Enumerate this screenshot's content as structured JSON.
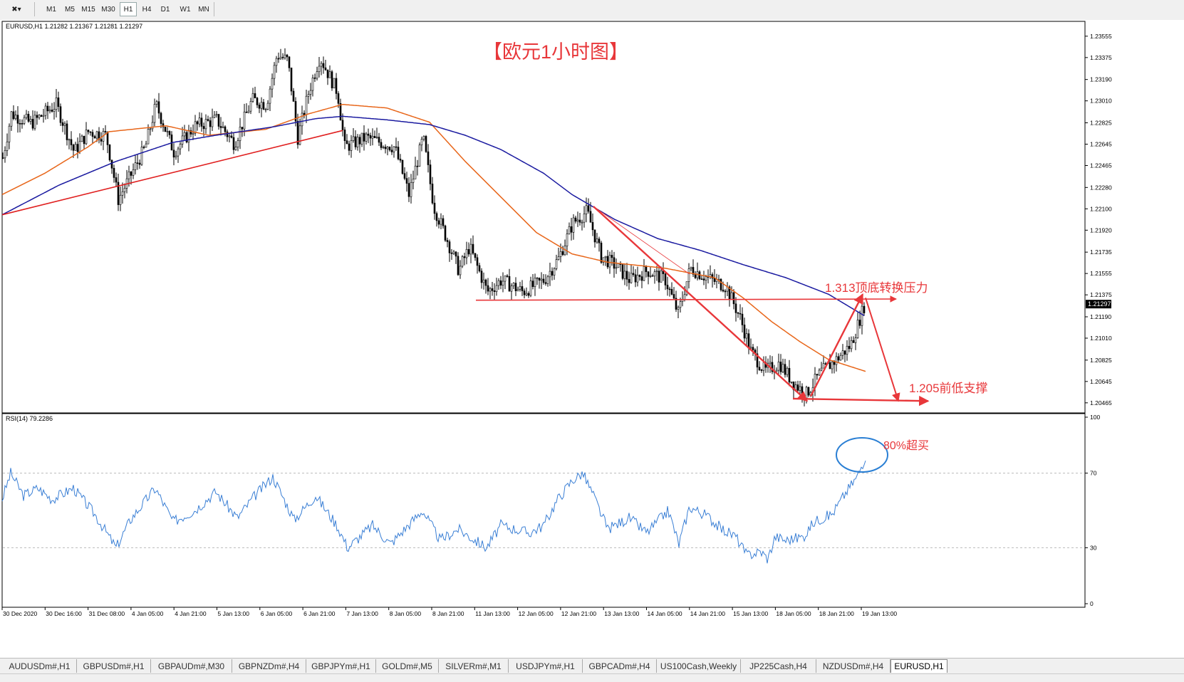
{
  "toolbar": {
    "cursor_tool": "crosshair-icon",
    "timeframes": [
      "M1",
      "M5",
      "M15",
      "M30",
      "H1",
      "H4",
      "D1",
      "W1",
      "MN"
    ],
    "active_timeframe": "H1"
  },
  "chart": {
    "header": "EURUSD,H1  1.21282 1.21367 1.21281 1.21297",
    "title": "【欧元1小时图】",
    "current_price": "1.21297",
    "price_ticks": [
      "1.23555",
      "1.23375",
      "1.23190",
      "1.23010",
      "1.22825",
      "1.22645",
      "1.22465",
      "1.22280",
      "1.22100",
      "1.21920",
      "1.21735",
      "1.21555",
      "1.21375",
      "1.21190",
      "1.21010",
      "1.20825",
      "1.20645",
      "1.20465"
    ],
    "time_ticks": [
      "30 Dec 2020",
      "30 Dec 16:00",
      "31 Dec 08:00",
      "4 Jan 05:00",
      "4 Jan 21:00",
      "5 Jan 13:00",
      "6 Jan 05:00",
      "6 Jan 21:00",
      "7 Jan 13:00",
      "8 Jan 05:00",
      "8 Jan 21:00",
      "11 Jan 13:00",
      "12 Jan 05:00",
      "12 Jan 21:00",
      "13 Jan 13:00",
      "14 Jan 05:00",
      "14 Jan 21:00",
      "15 Jan 13:00",
      "18 Jan 05:00",
      "18 Jan 21:00",
      "19 Jan 13:00"
    ],
    "annotations": {
      "resistance": "1.313顶底转换压力",
      "support": "1.205前低支撑",
      "overbought": "80%超买"
    },
    "colors": {
      "ema_orange": "#e8661a",
      "ma_blue": "#1a1aa0",
      "annotation_red": "#e8373a",
      "rsi_line": "#3a7fd5",
      "highlight_circle": "#2a7fd4"
    }
  },
  "rsi": {
    "header": "RSI(14) 79.2286",
    "levels": [
      "100",
      "70",
      "30",
      "0"
    ]
  },
  "tabs": {
    "items": [
      "AUDUSDm#,H1",
      "GBPUSDm#,H1",
      "GBPAUDm#,M30",
      "GBPNZDm#,H4",
      "GBPJPYm#,H1",
      "GOLDm#,M5",
      "SILVERm#,M1",
      "USDJPYm#,H1",
      "GBPCADm#,H4",
      "US100Cash,Weekly",
      "JP225Cash,H4",
      "NZDUSDm#,H4",
      "EURUSD,H1"
    ],
    "active": "EURUSD,H1"
  },
  "chart_data": {
    "type": "candlestick",
    "symbol": "EURUSD",
    "timeframe": "H1",
    "ylim": [
      1.2038,
      1.2368
    ],
    "price_path_knots": [
      [
        0,
        1.2253
      ],
      [
        12,
        1.229
      ],
      [
        40,
        1.2282
      ],
      [
        75,
        1.2298
      ],
      [
        100,
        1.2258
      ],
      [
        120,
        1.2275
      ],
      [
        145,
        1.2272
      ],
      [
        162,
        1.2218
      ],
      [
        200,
        1.2262
      ],
      [
        215,
        1.2298
      ],
      [
        240,
        1.2258
      ],
      [
        270,
        1.228
      ],
      [
        300,
        1.2285
      ],
      [
        325,
        1.2265
      ],
      [
        350,
        1.2302
      ],
      [
        370,
        1.2298
      ],
      [
        385,
        1.234
      ],
      [
        400,
        1.2335
      ],
      [
        414,
        1.227
      ],
      [
        430,
        1.231
      ],
      [
        445,
        1.2338
      ],
      [
        470,
        1.2308
      ],
      [
        480,
        1.2262
      ],
      [
        510,
        1.227
      ],
      [
        550,
        1.2262
      ],
      [
        570,
        1.2222
      ],
      [
        590,
        1.227
      ],
      [
        605,
        1.2212
      ],
      [
        625,
        1.2182
      ],
      [
        640,
        1.2158
      ],
      [
        655,
        1.2178
      ],
      [
        680,
        1.214
      ],
      [
        700,
        1.215
      ],
      [
        730,
        1.214
      ],
      [
        760,
        1.215
      ],
      [
        780,
        1.2168
      ],
      [
        800,
        1.2198
      ],
      [
        820,
        1.2208
      ],
      [
        840,
        1.217
      ],
      [
        860,
        1.2162
      ],
      [
        880,
        1.215
      ],
      [
        905,
        1.2158
      ],
      [
        930,
        1.215
      ],
      [
        948,
        1.2122
      ],
      [
        965,
        1.216
      ],
      [
        995,
        1.215
      ],
      [
        1015,
        1.2145
      ],
      [
        1035,
        1.2118
      ],
      [
        1050,
        1.209
      ],
      [
        1070,
        1.2073
      ],
      [
        1090,
        1.208
      ],
      [
        1110,
        1.2063
      ],
      [
        1128,
        1.2054
      ],
      [
        1148,
        1.2072
      ],
      [
        1170,
        1.2083
      ],
      [
        1190,
        1.2095
      ],
      [
        1200,
        1.2112
      ],
      [
        1210,
        1.213
      ]
    ],
    "series": [
      {
        "name": "orange moving average",
        "knots": [
          [
            0,
            1.2222
          ],
          [
            60,
            1.224
          ],
          [
            120,
            1.2262
          ],
          [
            150,
            1.2275
          ],
          [
            230,
            1.228
          ],
          [
            290,
            1.2272
          ],
          [
            370,
            1.2277
          ],
          [
            430,
            1.229
          ],
          [
            478,
            1.2298
          ],
          [
            540,
            1.2295
          ],
          [
            600,
            1.2283
          ],
          [
            650,
            1.225
          ],
          [
            700,
            1.222
          ],
          [
            750,
            1.219
          ],
          [
            800,
            1.2172
          ],
          [
            850,
            1.2165
          ],
          [
            930,
            1.216
          ],
          [
            1000,
            1.2152
          ],
          [
            1040,
            1.2135
          ],
          [
            1080,
            1.2115
          ],
          [
            1120,
            1.2098
          ],
          [
            1160,
            1.2083
          ],
          [
            1212,
            1.2073
          ]
        ]
      },
      {
        "name": "blue moving average",
        "knots": [
          [
            0,
            1.2205
          ],
          [
            80,
            1.223
          ],
          [
            160,
            1.225
          ],
          [
            240,
            1.2266
          ],
          [
            300,
            1.2272
          ],
          [
            380,
            1.2279
          ],
          [
            440,
            1.2286
          ],
          [
            478,
            1.2288
          ],
          [
            540,
            1.2285
          ],
          [
            600,
            1.2281
          ],
          [
            650,
            1.2272
          ],
          [
            700,
            1.226
          ],
          [
            760,
            1.224
          ],
          [
            800,
            1.2222
          ],
          [
            860,
            1.2201
          ],
          [
            920,
            1.2185
          ],
          [
            980,
            1.2175
          ],
          [
            1040,
            1.2163
          ],
          [
            1100,
            1.2152
          ],
          [
            1160,
            1.2138
          ],
          [
            1210,
            1.212
          ]
        ]
      }
    ],
    "trendlines": [
      {
        "name": "ascending support",
        "points": [
          [
            0,
            1.2205
          ],
          [
            478,
            1.2276
          ]
        ],
        "color": "#e02020"
      },
      {
        "name": "1.213 resistance",
        "points": [
          [
            665,
            1.2133
          ],
          [
            1255,
            1.2134
          ]
        ],
        "color": "#e8373a"
      },
      {
        "name": "1.205 support",
        "points": [
          [
            1110,
            1.205
          ],
          [
            1300,
            1.2048
          ]
        ],
        "color": "#e8373a"
      },
      {
        "name": "downtrend",
        "points": [
          [
            830,
            1.2212
          ],
          [
            1130,
            1.2048
          ]
        ],
        "color": "#e8373a"
      },
      {
        "name": "rebound",
        "points": [
          [
            1135,
            1.2052
          ],
          [
            1208,
            1.2138
          ]
        ],
        "color": "#e8373a"
      },
      {
        "name": "projected drop",
        "points": [
          [
            1212,
            1.2135
          ],
          [
            1258,
            1.2048
          ]
        ],
        "color": "#e8373a"
      }
    ],
    "rsi": {
      "period": 14,
      "last_value": 79.2286,
      "levels": [
        70,
        30
      ],
      "ylim": [
        0,
        100
      ],
      "knots": [
        [
          0,
          56
        ],
        [
          12,
          70
        ],
        [
          30,
          58
        ],
        [
          50,
          62
        ],
        [
          70,
          56
        ],
        [
          100,
          62
        ],
        [
          130,
          48
        ],
        [
          160,
          30
        ],
        [
          180,
          45
        ],
        [
          215,
          62
        ],
        [
          240,
          44
        ],
        [
          270,
          50
        ],
        [
          300,
          60
        ],
        [
          330,
          46
        ],
        [
          355,
          58
        ],
        [
          380,
          68
        ],
        [
          410,
          45
        ],
        [
          440,
          58
        ],
        [
          470,
          42
        ],
        [
          485,
          30
        ],
        [
          520,
          42
        ],
        [
          545,
          32
        ],
        [
          570,
          42
        ],
        [
          590,
          50
        ],
        [
          615,
          34
        ],
        [
          640,
          40
        ],
        [
          680,
          30
        ],
        [
          700,
          42
        ],
        [
          740,
          38
        ],
        [
          760,
          42
        ],
        [
          780,
          56
        ],
        [
          800,
          66
        ],
        [
          815,
          70
        ],
        [
          830,
          58
        ],
        [
          850,
          40
        ],
        [
          880,
          46
        ],
        [
          905,
          38
        ],
        [
          935,
          50
        ],
        [
          950,
          32
        ],
        [
          965,
          52
        ],
        [
          990,
          47
        ],
        [
          1010,
          40
        ],
        [
          1030,
          36
        ],
        [
          1045,
          26
        ],
        [
          1065,
          28
        ],
        [
          1075,
          24
        ],
        [
          1085,
          36
        ],
        [
          1100,
          34
        ],
        [
          1125,
          36
        ],
        [
          1140,
          44
        ],
        [
          1165,
          48
        ],
        [
          1185,
          60
        ],
        [
          1200,
          68
        ],
        [
          1212,
          79
        ]
      ]
    },
    "ellipse_highlight": {
      "index": 1207,
      "value": 79
    }
  }
}
